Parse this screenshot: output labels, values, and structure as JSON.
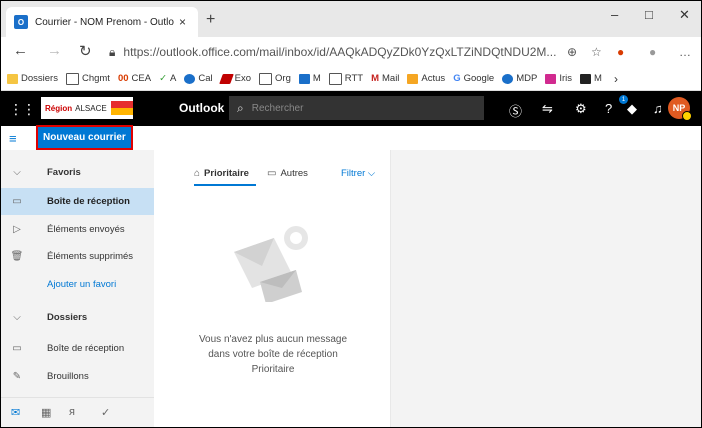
{
  "browser": {
    "tab_title": "Courrier - NOM Prenom - Outlo",
    "tab_close": "×",
    "new_tab": "+",
    "url": "https://outlook.office.com/mail/inbox/id/AAQkADQyZDk0YzQxLTZiNDQtNDU2M...",
    "win_min": "–",
    "win_max": "□",
    "win_close": "✕"
  },
  "bookmarks": [
    {
      "label": "Dossiers",
      "color": "#f5c542"
    },
    {
      "label": "Chgmt",
      "color": "#555555"
    },
    {
      "label": "CEA",
      "glyph": "00",
      "color": "#d83b01"
    },
    {
      "label": "A",
      "glyph": "✓",
      "color": "#3aa13a"
    },
    {
      "label": "Cal",
      "color": "#1a6fc9"
    },
    {
      "label": "Exo",
      "color": "#c00000"
    },
    {
      "label": "Org",
      "color": "#555555"
    },
    {
      "label": "M",
      "color": "#1a6fc9"
    },
    {
      "label": "RTT",
      "color": "#555555"
    },
    {
      "label": "Mail",
      "glyph": "M",
      "color": "#c5221f"
    },
    {
      "label": "Actus",
      "color": "#f5a623"
    },
    {
      "label": "Google",
      "glyph": "G",
      "color": "#4285f4"
    },
    {
      "label": "MDP",
      "color": "#1a6fc9"
    },
    {
      "label": "Iris",
      "color": "#d12a8f"
    },
    {
      "label": "M",
      "color": "#222222"
    }
  ],
  "header": {
    "org_text": "ALSACE",
    "org_prefix": "Région",
    "app_name": "Outlook",
    "search_placeholder": "Rechercher",
    "avatar_initials": "NP",
    "badge": "1"
  },
  "toolbar": {
    "new_mail": "Nouveau courrier"
  },
  "folders": {
    "favorites_header": "Favoris",
    "fav_items": [
      {
        "label": "Boîte de réception",
        "selected": true
      },
      {
        "label": "Éléments envoyés"
      },
      {
        "label": "Éléments supprimés"
      }
    ],
    "add_favorite": "Ajouter un favori",
    "folders_header": "Dossiers",
    "folder_items": [
      {
        "label": "Boîte de réception"
      },
      {
        "label": "Brouillons"
      }
    ]
  },
  "message_list": {
    "tab_focused": "Prioritaire",
    "tab_other": "Autres",
    "filter": "Filtrer",
    "empty_text": "Vous n'avez plus aucun message dans votre boîte de réception Prioritaire"
  },
  "colors": {
    "accent": "#0078d4",
    "highlight_box": "#e00000",
    "selection": "#c7e0f4"
  }
}
